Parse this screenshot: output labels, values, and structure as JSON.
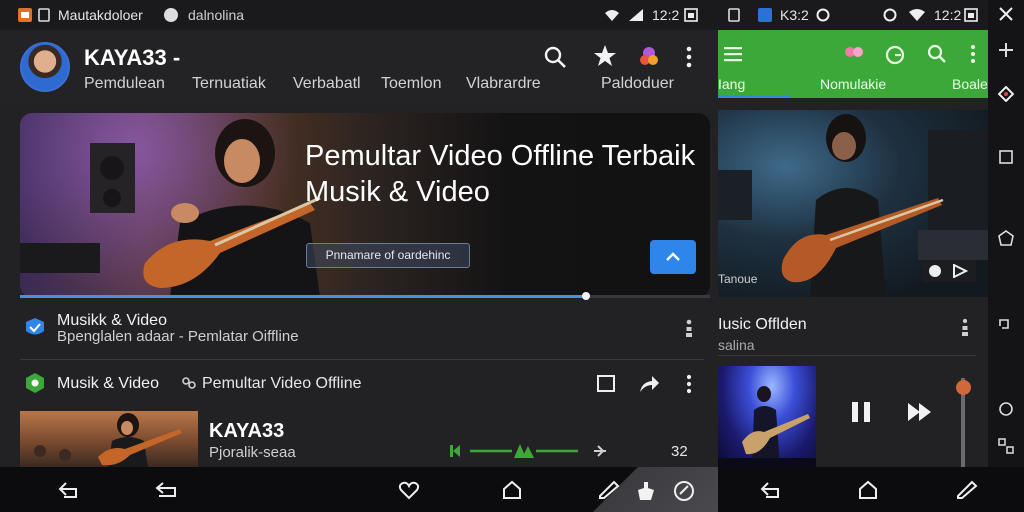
{
  "status_left": {
    "app_name": "Mautakdoloer",
    "label": "dalnolina",
    "time": "12:2"
  },
  "status_right": {
    "time_text": "K3:2",
    "time": "12:2"
  },
  "header": {
    "channel_name": "KAYA33 -",
    "tabs": [
      "Pemdulean",
      "Ternuatiak",
      "Verbabatl",
      "Toemlon",
      "Vlabrardre",
      "Paldoduer"
    ]
  },
  "hero": {
    "title_line1": "Pemultar Video Offline Terbaik",
    "title_line2": "Musik & Video",
    "chip_label": "Pnnamare of oardehinc",
    "progress": 0.82
  },
  "row1": {
    "title": "Musikk & Video",
    "subtitle": "Bpenglalen adaar - Pemlatar Oiffline"
  },
  "row2": {
    "title": "Musik & Video",
    "subtitle": "Pemultar Video Offline"
  },
  "item": {
    "title": "KAYA33",
    "subtitle": "Pjoralik-seaa",
    "count": "32"
  },
  "right_panel": {
    "tabs": [
      "Iang",
      "Nomulakie",
      "Boale"
    ],
    "video_time": "Tanoue",
    "row_title": "Iusic Offlden",
    "row_subtitle": "salina",
    "volume": 0.9
  },
  "colors": {
    "accent_blue": "#2f86ea",
    "accent_green": "#3da83a",
    "slider_orange": "#d2683a"
  },
  "icons": [
    "search-icon",
    "star-icon",
    "color-drop-icon",
    "more-vert-icon",
    "menu-icon",
    "play-icon",
    "pause-icon",
    "bookmark-icon",
    "share-icon"
  ]
}
